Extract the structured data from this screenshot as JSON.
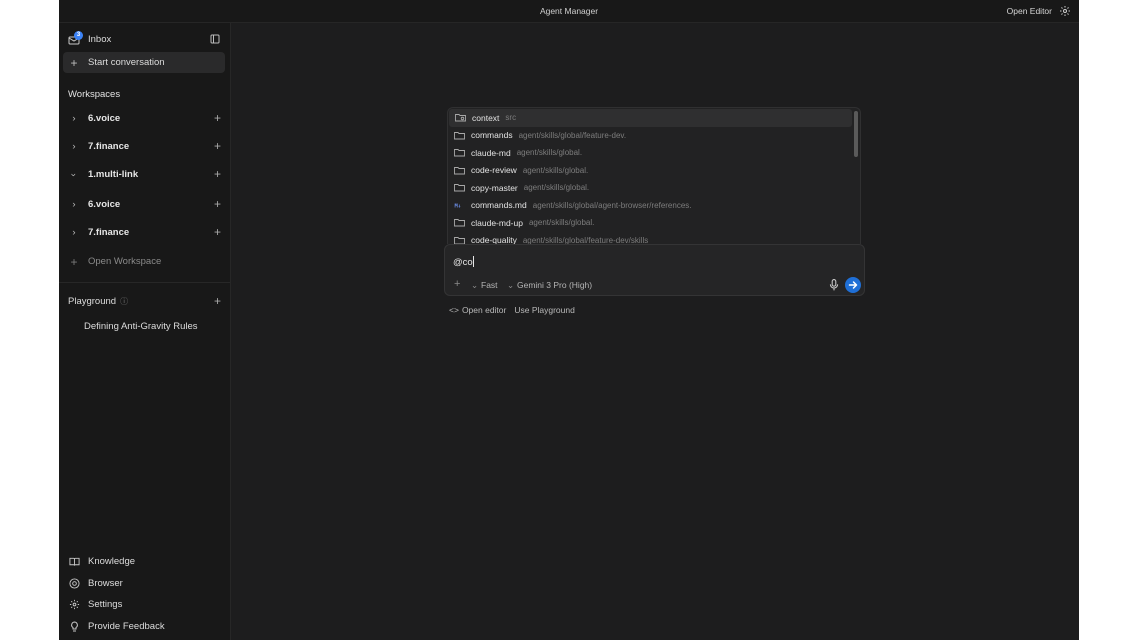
{
  "window": {
    "title": "Agent Manager",
    "open_editor": "Open Editor"
  },
  "sidebar": {
    "inbox": {
      "label": "Inbox",
      "badge": "3"
    },
    "start_conversation": "Start conversation",
    "workspaces_title": "Workspaces",
    "workspaces": [
      {
        "label": "6.voice",
        "expanded": false
      },
      {
        "label": "7.finance",
        "expanded": false
      },
      {
        "label": "1.multi-link",
        "expanded": true
      },
      {
        "label": "6.voice",
        "expanded": false
      },
      {
        "label": "7.finance",
        "expanded": false
      }
    ],
    "open_workspace": "Open Workspace",
    "playground_title": "Playground",
    "playground_items": [
      "Defining Anti-Gravity Rules"
    ],
    "footer": [
      {
        "label": "Knowledge",
        "icon": "book-icon"
      },
      {
        "label": "Browser",
        "icon": "chrome-icon"
      },
      {
        "label": "Settings",
        "icon": "gear-icon"
      },
      {
        "label": "Provide Feedback",
        "icon": "lightbulb-icon"
      }
    ]
  },
  "suggestions": [
    {
      "name": "context",
      "path": "src",
      "icon": "folder-icon",
      "active": true
    },
    {
      "name": "commands",
      "path": "agent/skills/global/feature-dev.",
      "icon": "folder-icon"
    },
    {
      "name": "claude-md",
      "path": "agent/skills/global.",
      "icon": "folder-icon"
    },
    {
      "name": "code-review",
      "path": "agent/skills/global.",
      "icon": "folder-icon"
    },
    {
      "name": "copy-master",
      "path": "agent/skills/global.",
      "icon": "folder-icon"
    },
    {
      "name": "commands.md",
      "path": "agent/skills/global/agent-browser/references.",
      "icon": "markdown-icon"
    },
    {
      "name": "claude-md-up",
      "path": "agent/skills/global.",
      "icon": "folder-icon"
    },
    {
      "name": "code-quality",
      "path": "agent/skills/global/feature-dev/skills",
      "icon": "folder-icon"
    }
  ],
  "composer": {
    "value": "@co",
    "mode": "Fast",
    "model": "Gemini 3 Pro (High)"
  },
  "links": {
    "open_editor": "Open editor",
    "use_playground": "Use Playground"
  },
  "colors": {
    "accent": "#1f6fd6",
    "badge": "#3b82f6",
    "background": "#1d1d1e",
    "sidebar": "#181818"
  }
}
